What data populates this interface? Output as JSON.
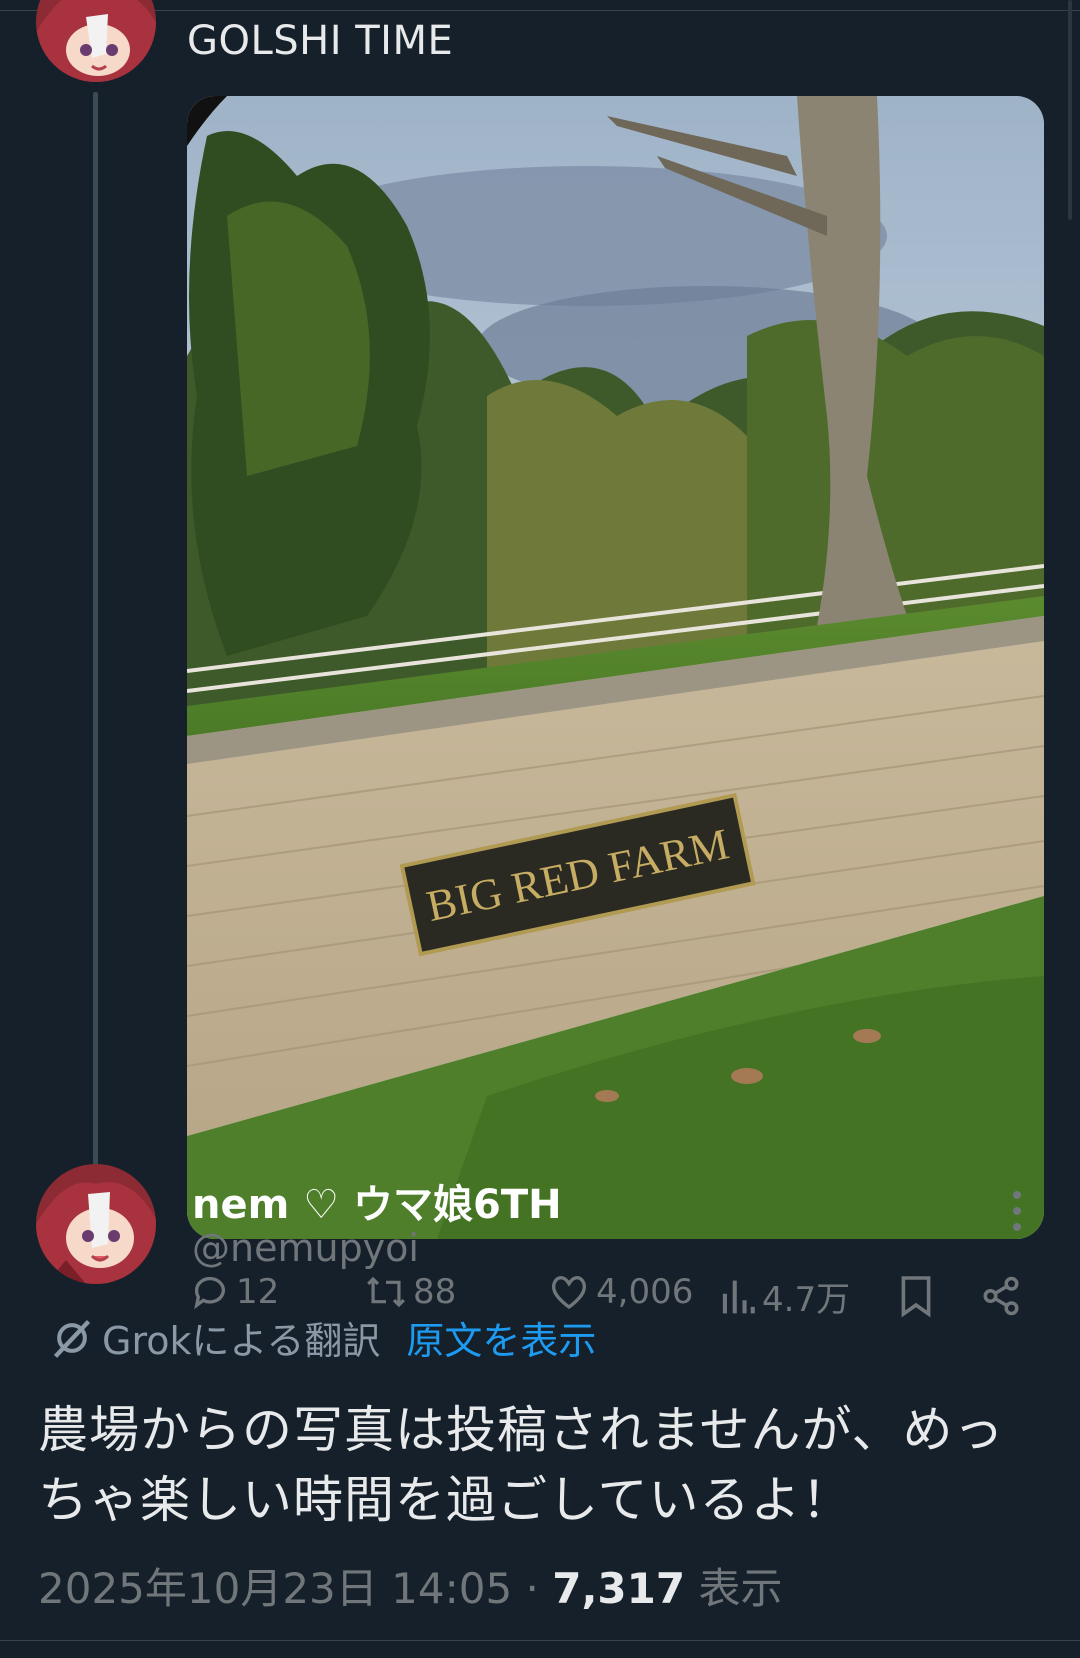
{
  "previous_post": {
    "title": "GOLSHI TIME"
  },
  "photo": {
    "sign_text": "BIG RED FARM"
  },
  "post": {
    "display_name": "nem ♡ ウマ娘6TH",
    "handle": "@nemupyoi",
    "translation": {
      "label": "Grokによる翻訳",
      "show_original": "原文を表示"
    },
    "text": "農場からの写真は投稿されませんが、めっちゃ楽しい時間を過ごしているよ！",
    "timestamp": "2025年10月23日 14:05",
    "separator": " · ",
    "views_count": "7,317",
    "views_label": " 表示"
  },
  "actions": {
    "replies": "12",
    "reposts": "88",
    "likes": "4,006",
    "views": "4.7万"
  },
  "colors": {
    "background": "#15202b",
    "text": "#e7e9ea",
    "muted": "#71767b",
    "link": "#1d9bf0"
  }
}
